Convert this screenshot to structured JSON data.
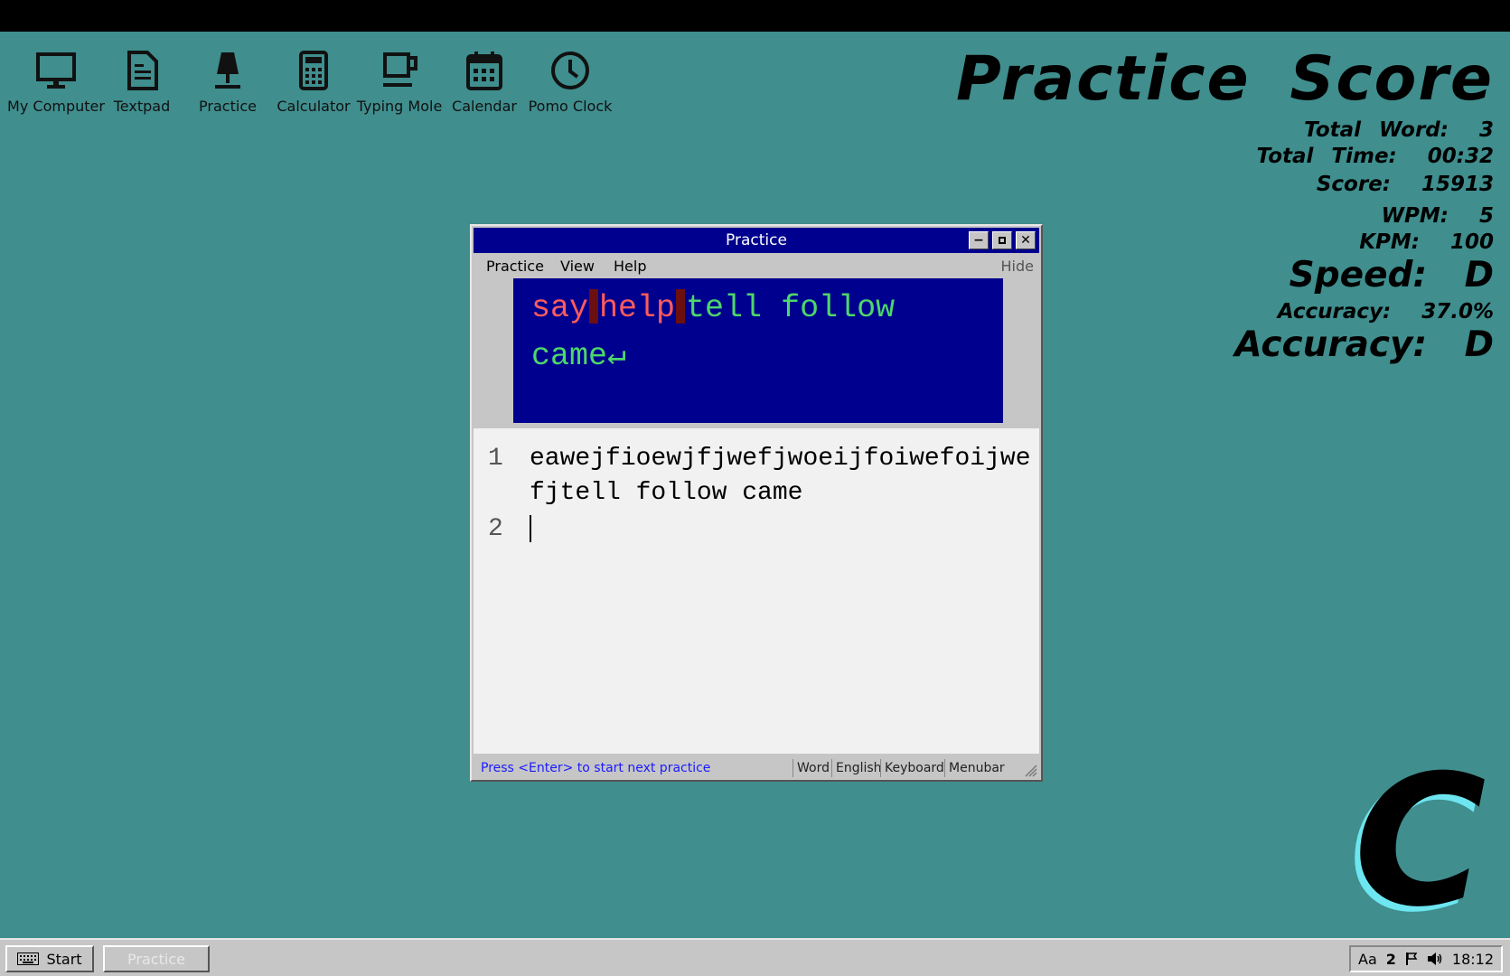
{
  "desktop_icons": [
    {
      "label": "My Computer",
      "icon": "monitor-icon"
    },
    {
      "label": "Textpad",
      "icon": "document-icon"
    },
    {
      "label": "Practice",
      "icon": "lamp-icon"
    },
    {
      "label": "Calculator",
      "icon": "calculator-icon"
    },
    {
      "label": "Typing Mole",
      "icon": "mug-icon"
    },
    {
      "label": "Calendar",
      "icon": "calendar-icon"
    },
    {
      "label": "Pomo Clock",
      "icon": "clock-icon"
    }
  ],
  "score": {
    "title": "Practice Score",
    "total_word_label": "Total Word:",
    "total_word": "3",
    "total_time_label": "Total Time:",
    "total_time": "00:32",
    "score_label": "Score:",
    "score": "15913",
    "wpm_label": "WPM:",
    "wpm": "5",
    "kpm_label": "KPM:",
    "kpm": "100",
    "speed_label": "Speed:",
    "speed": "D",
    "accuracy_pct_label": "Accuracy:",
    "accuracy_pct": "37.0%",
    "accuracy_grade_label": "Accuracy:",
    "accuracy_grade": "D"
  },
  "grade": {
    "letter": "C",
    "icon": "grade-c-emblem"
  },
  "window": {
    "title": "Practice",
    "menu": [
      "Practice",
      "View",
      "Help"
    ],
    "hide_label": "Hide",
    "prompt": {
      "words": [
        "say",
        "help",
        "tell",
        "follow",
        "came"
      ],
      "return_symbol": "↵"
    },
    "editor": {
      "line_numbers": [
        "1",
        "2"
      ],
      "line1_part1": "eawejfioewjfjwefjwoeijfoiwefoijwe",
      "line1_part2": "fjtell follow came"
    },
    "status": {
      "message": "Press <Enter> to start next practice",
      "cells": [
        "Word",
        "English",
        "Keyboard",
        "Menubar"
      ]
    }
  },
  "taskbar": {
    "start_label": "Start",
    "task_label": "Practice",
    "tray_input": "Aa",
    "tray_number": "2",
    "clock": "18:12"
  },
  "colors": {
    "desktop": "#408e8e",
    "title_bar": "#00008e",
    "wrong_word": "#ff5c5c",
    "correct_word": "#4ed66b",
    "grade_glow": "#6de6f0"
  }
}
